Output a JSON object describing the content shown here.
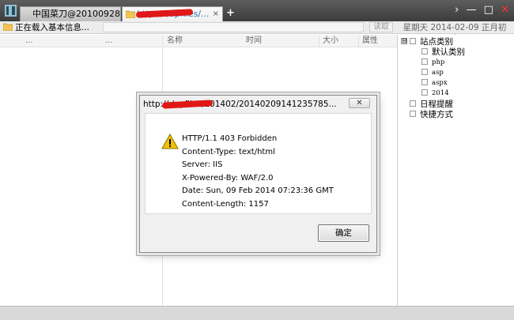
{
  "tabs": [
    {
      "label": "中国菜刀@20100928"
    },
    {
      "label": "http://         /upfiles/...",
      "close": "×"
    }
  ],
  "new_tab_label": "+",
  "window_controls": {
    "menu": "›",
    "minimize": "—",
    "maximize": "□",
    "close": "✕"
  },
  "status": {
    "text": "正在载入基本信息...",
    "search_label": "读取",
    "date": "星期天 2014-02-09 正月初十"
  },
  "columns": [
    "...",
    "...",
    "名称",
    "时间",
    "大小",
    "属性"
  ],
  "tree": {
    "root": "站点类别",
    "root_expander": "⊟",
    "children": [
      "默认类别",
      "php",
      "asp",
      "aspx",
      "2014"
    ],
    "extras": [
      "日程提醒",
      "快捷方式"
    ]
  },
  "dialog": {
    "title": "http://         /upfiles/201402/20140209141235785...",
    "close_label": "✕",
    "lines": [
      "HTTP/1.1 403 Forbidden",
      "Content-Type: text/html",
      "Server: IIS",
      "X-Powered-By: WAF/2.0",
      "Date: Sun, 09 Feb 2014 07:23:36 GMT",
      "Content-Length: 1157"
    ],
    "ok_label": "确定"
  },
  "colors": {
    "titlebar": "#3c3c3c",
    "accent_link": "#2a6fb3",
    "redaction": "#e01818",
    "warning": "#f2c200"
  },
  "icons": [
    "app-icon",
    "folder-icon",
    "warning-icon",
    "close-icon",
    "calendar-icon",
    "shortcut-icon"
  ]
}
